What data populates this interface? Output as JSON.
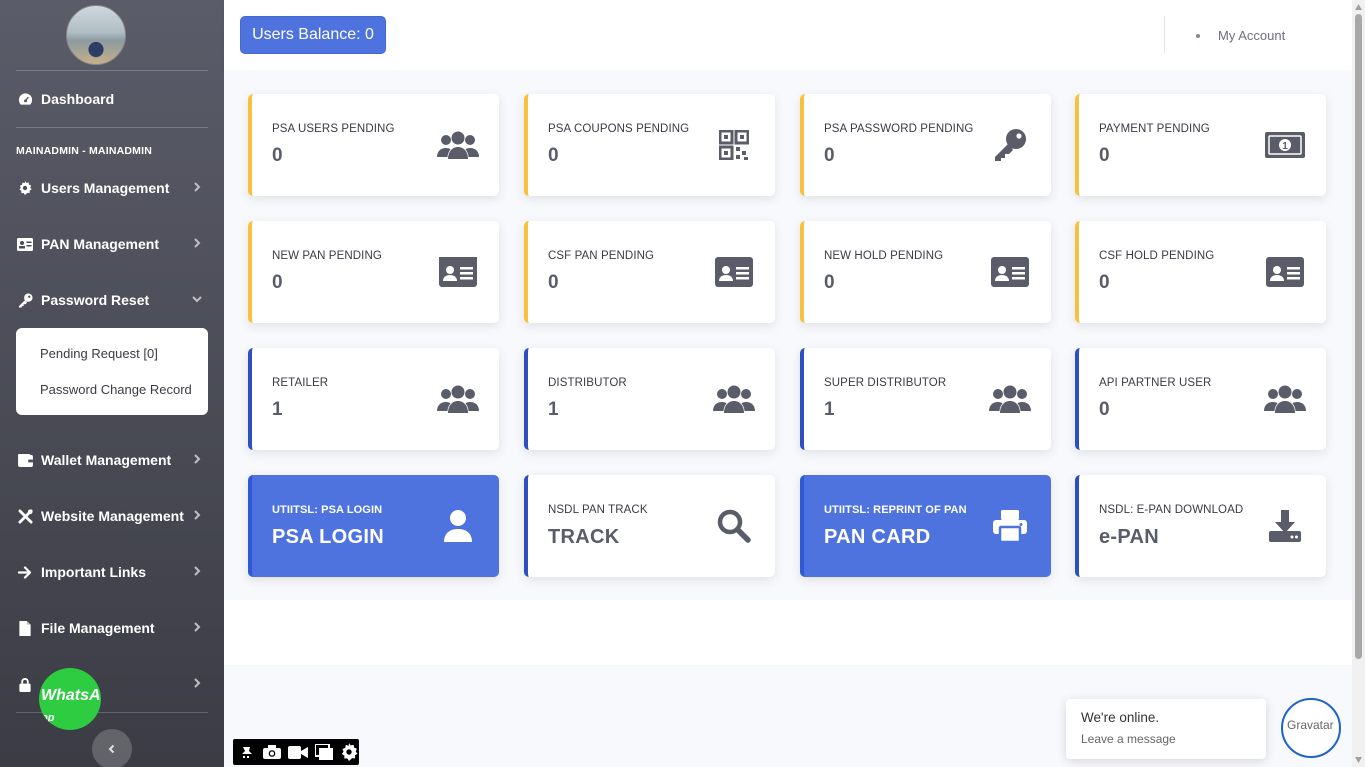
{
  "sidebar": {
    "dashboard_label": "Dashboard",
    "section_heading": "MAINADMIN - MAINADMIN",
    "items": [
      {
        "label": "Users Management",
        "icon": "gear-icon"
      },
      {
        "label": "PAN Management",
        "icon": "id-card-icon"
      },
      {
        "label": "Password Reset",
        "icon": "key-icon"
      },
      {
        "label": "Wallet Management",
        "icon": "wallet-icon"
      },
      {
        "label": "Website Management",
        "icon": "tools-icon"
      },
      {
        "label": "Important Links",
        "icon": "arrow-right-icon"
      },
      {
        "label": "File Management",
        "icon": "file-icon"
      }
    ],
    "password_submenu": [
      "Pending Request [0]",
      "Password Change Record"
    ],
    "whatsapp_label": "WhatsA",
    "whatsapp_sub": "pp"
  },
  "topbar": {
    "balance_label": "Users Balance: 0",
    "account_label": "My Account"
  },
  "cards": [
    {
      "label": "PSA USERS PENDING",
      "value": "0",
      "icon": "users-icon"
    },
    {
      "label": "PSA COUPONS PENDING",
      "value": "0",
      "icon": "qrcode-icon"
    },
    {
      "label": "PSA PASSWORD PENDING",
      "value": "0",
      "icon": "key-icon"
    },
    {
      "label": "PAYMENT PENDING",
      "value": "0",
      "icon": "money-bill-icon"
    },
    {
      "label": "NEW PAN PENDING",
      "value": "0",
      "icon": "id-card-icon"
    },
    {
      "label": "CSF PAN PENDING",
      "value": "0",
      "icon": "id-card-icon"
    },
    {
      "label": "NEW HOLD PENDING",
      "value": "0",
      "icon": "id-card-icon"
    },
    {
      "label": "CSF HOLD PENDING",
      "value": "0",
      "icon": "id-card-icon"
    },
    {
      "label": "RETAILER",
      "value": "1",
      "icon": "users-icon"
    },
    {
      "label": "DISTRIBUTOR",
      "value": "1",
      "icon": "users-icon"
    },
    {
      "label": "SUPER DISTRIBUTOR",
      "value": "1",
      "icon": "users-icon"
    },
    {
      "label": "API PARTNER USER",
      "value": "0",
      "icon": "users-icon"
    },
    {
      "label": "UTIITSL: PSA LOGIN",
      "value": "PSA LOGIN",
      "icon": "user-icon"
    },
    {
      "label": "NSDL PAN TRACK",
      "value": "TRACK",
      "icon": "search-icon"
    },
    {
      "label": "UTIITSL: REPRINT OF PAN",
      "value": "PAN CARD",
      "icon": "print-icon"
    },
    {
      "label": "NSDL: E-PAN DOWNLOAD",
      "value": "e-PAN",
      "icon": "download-icon"
    }
  ],
  "chat": {
    "line1": "We're online.",
    "line2": "Leave a message",
    "avatar_alt": "Gravatar"
  },
  "colors": {
    "primary": "#4e73df",
    "warning_border": "#f6c23e",
    "blue_border": "#2d4fbf",
    "sidebar_bg": "#5a5c69"
  }
}
